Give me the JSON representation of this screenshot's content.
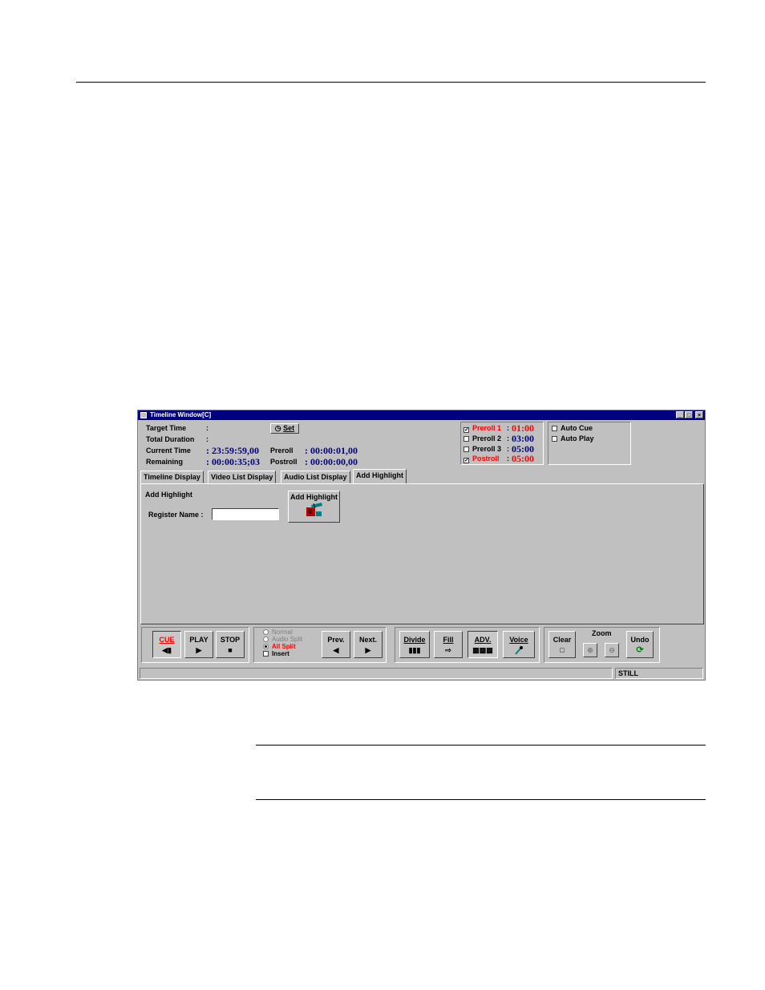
{
  "window": {
    "title": "Timeline Window[C]",
    "controls": {
      "minimize": "_",
      "restore": "□",
      "close": "×"
    }
  },
  "info": {
    "target_time_label": "Target Time",
    "target_time_sep": ":",
    "total_duration_label": "Total Duration",
    "total_duration_sep": ":",
    "current_time_label": "Current Time",
    "current_time_value": ": 23:59:59,00",
    "remaining_label": "Remaining",
    "remaining_value": ": 00:00:35;03",
    "preroll_label": "Preroll",
    "preroll_value": ": 00:00:01,00",
    "postroll_label": "Postroll",
    "postroll_value": ": 00:00:00,00",
    "set_button": "Set",
    "set_icon": "clock-icon"
  },
  "rolls": [
    {
      "label": "Preroll 1",
      "value": "01:00",
      "checked": true,
      "color": "#ff0000"
    },
    {
      "label": "Preroll 2",
      "value": "03:00",
      "checked": false,
      "color": "#000080"
    },
    {
      "label": "Preroll 3",
      "value": "05:00",
      "checked": false,
      "color": "#000080"
    },
    {
      "label": "Postroll",
      "value": "05:00",
      "checked": true,
      "color": "#ff0000"
    }
  ],
  "roll_sep": ":",
  "auto": {
    "cue": "Auto Cue",
    "play": "Auto Play"
  },
  "tabs": [
    "Timeline Display",
    "Video List Display",
    "Audio List Display",
    "Add Highlight"
  ],
  "active_tab": 3,
  "highlight": {
    "heading": "Add Highlight",
    "register_label": "Register Name :",
    "register_value": "",
    "add_button": "Add Highlight"
  },
  "transport": {
    "cue": "CUE",
    "play": "PLAY",
    "stop": "STOP"
  },
  "modes": {
    "normal": "Normal",
    "audio_split": "Audio Split",
    "all_split": "All Split",
    "insert": "Insert",
    "prev": "Prev.",
    "next": "Next."
  },
  "edit": {
    "divide": "Divide",
    "fill": "Fill",
    "adv": "ADV.",
    "voice": "Voice"
  },
  "tools": {
    "clear": "Clear",
    "zoom": "Zoom",
    "undo": "Undo"
  },
  "status": {
    "mode": "STILL"
  },
  "colors": {
    "title_bar": "#000080",
    "face": "#c0c0c0",
    "accent_red": "#ff0000",
    "accent_blue": "#000080"
  }
}
